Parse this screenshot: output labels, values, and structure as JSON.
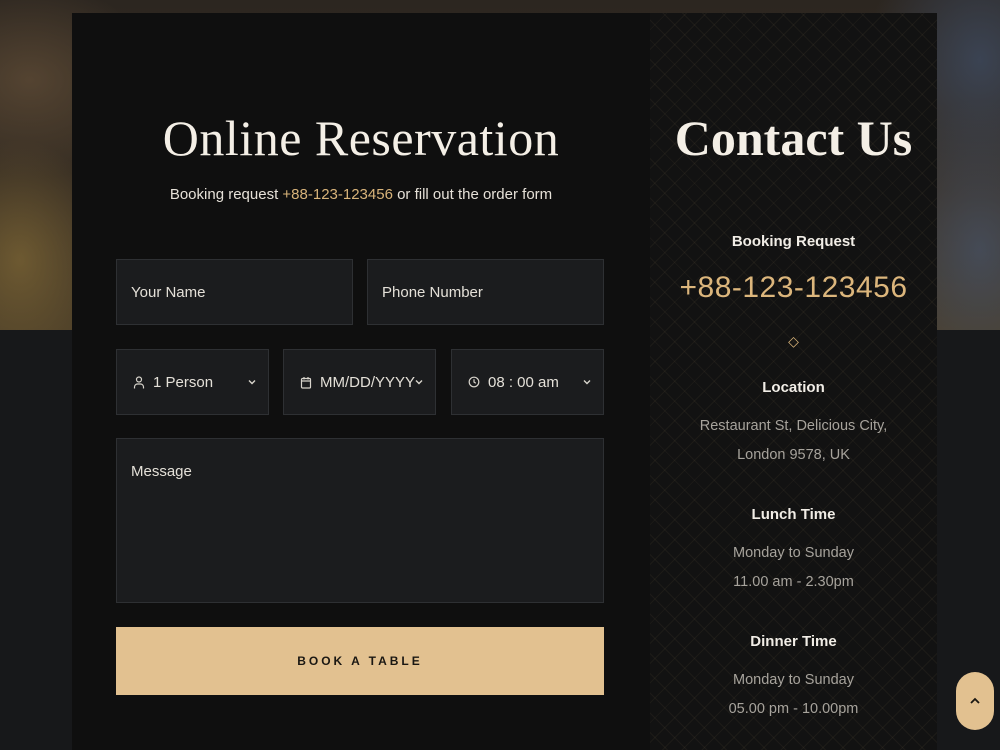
{
  "reservation": {
    "title": "Online Reservation",
    "subtitle_prefix": "Booking request ",
    "subtitle_phone": "+88-123-123456",
    "subtitle_suffix": " or fill out the order form",
    "name_placeholder": "Your Name",
    "phone_placeholder": "Phone Number",
    "persons_value": "1 Person",
    "date_value": "MM/DD/YYYY",
    "time_value": "08 : 00 am",
    "message_placeholder": "Message",
    "button_label": "BOOK A TABLE"
  },
  "contact": {
    "title": "Contact Us",
    "booking_heading": "Booking Request",
    "booking_phone": "+88-123-123456",
    "separator": "◇",
    "location_heading": "Location",
    "location_line1": "Restaurant St, Delicious City,",
    "location_line2": "London 9578, UK",
    "lunch_heading": "Lunch Time",
    "lunch_days": "Monday to Sunday",
    "lunch_hours": "11.00 am - 2.30pm",
    "dinner_heading": "Dinner Time",
    "dinner_days": "Monday to Sunday",
    "dinner_hours": "05.00 pm - 10.00pm"
  },
  "icons": {
    "person": "person-icon",
    "calendar": "calendar-icon",
    "clock": "clock-icon",
    "chevron": "chevron-down-icon",
    "scroll_top": "chevron-up-icon"
  },
  "colors": {
    "accent": "#e2c190",
    "accent_text": "#d9b47a",
    "card_bg": "#0f0f0f",
    "field_bg": "#1b1c1e"
  }
}
